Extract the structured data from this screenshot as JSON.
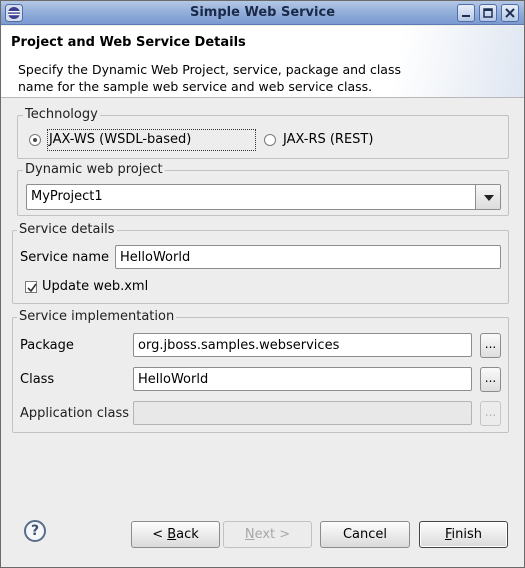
{
  "window": {
    "title": "Simple Web Service"
  },
  "banner": {
    "heading": "Project and Web Service Details",
    "description": "Specify the Dynamic Web Project, service, package and class name for the sample web service and web service class."
  },
  "technology": {
    "label": "Technology",
    "options": [
      {
        "label": "JAX-WS (WSDL-based)",
        "selected": true
      },
      {
        "label": "JAX-RS (REST)",
        "selected": false
      }
    ]
  },
  "project": {
    "label": "Dynamic web project",
    "value": "MyProject1"
  },
  "service_details": {
    "label": "Service details",
    "name_label": "Service name",
    "name_value": "HelloWorld",
    "update_label": "Update web.xml",
    "update_checked": true
  },
  "implementation": {
    "label": "Service implementation",
    "package_label": "Package",
    "package_value": "org.jboss.samples.webservices",
    "class_label": "Class",
    "class_value": "HelloWorld",
    "app_class_label": "Application class",
    "app_class_value": "",
    "browse_label": "..."
  },
  "footer": {
    "help_icon": "?",
    "back_prefix": "< ",
    "back_mnemonic": "B",
    "back_rest": "ack",
    "next_label": "Next >",
    "next_mnemonic": "N",
    "next_rest": "ext >",
    "cancel_label": "Cancel",
    "finish_mnemonic": "F",
    "finish_rest": "inish"
  },
  "icons": {
    "app": "eclipse-icon",
    "minimize": "minimize-icon",
    "maximize": "maximize-icon",
    "close": "close-icon",
    "help": "help-icon",
    "dropdown": "chevron-down-icon"
  }
}
